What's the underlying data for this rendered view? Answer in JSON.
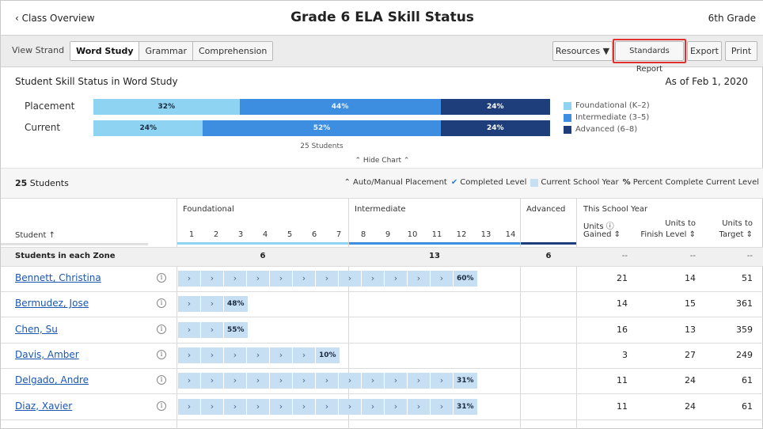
{
  "header": {
    "back_label": "Class Overview",
    "title": "Grade 6 ELA Skill Status",
    "grade": "6th Grade"
  },
  "toolbar": {
    "view_strand_label": "View Strand",
    "strand_tabs": [
      "Word Study",
      "Grammar",
      "Comprehension"
    ],
    "active_tab": "Word Study",
    "resources_label": "Resources ▼",
    "standards_label": "Standards Report",
    "export_label": "Export",
    "print_label": "Print"
  },
  "summary": {
    "title": "Student Skill Status in Word Study",
    "as_of": "As of Feb 1, 2020",
    "placement_label": "Placement",
    "current_label": "Current",
    "placement": [
      32,
      44,
      24
    ],
    "current": [
      24,
      52,
      24
    ],
    "placement_labels": [
      "32%",
      "44%",
      "24%"
    ],
    "current_labels": [
      "24%",
      "52%",
      "24%"
    ],
    "students_total": "25 Students",
    "hide_chart": "⌃ Hide Chart ⌃",
    "legend": [
      {
        "label": "Foundational (K–2)",
        "color": "#8fd3f2"
      },
      {
        "label": "Intermediate (3–5)",
        "color": "#3d8ee0"
      },
      {
        "label": "Advanced (6–8)",
        "color": "#1d3e7a"
      }
    ]
  },
  "students_band": {
    "count_bold": "25",
    "count_rest": " Students",
    "key_auto": "⌃ Auto/Manual Placement",
    "key_completed": "Completed Level",
    "key_current": "Current School Year",
    "key_percent_symbol": "%",
    "key_percent": "Percent Complete Current Level"
  },
  "table": {
    "student_header": "Student ↑",
    "zones": [
      "Foundational",
      "Intermediate",
      "Advanced"
    ],
    "levels": [
      "1",
      "2",
      "3",
      "4",
      "5",
      "6",
      "7",
      "8",
      "9",
      "10",
      "11",
      "12",
      "13",
      "14"
    ],
    "this_school_year": "This School Year",
    "units_gained": "Units ⓘ Gained ⇕",
    "units_gained_l1": "Units ⓘ",
    "units_gained_l2": "Gained ⇕",
    "units_finish_l1": "Units to",
    "units_finish_l2": "Finish Level ⇕",
    "units_target_l1": "Units to",
    "units_target_l2": "Target ⇕",
    "zone_row_label": "Students in each Zone",
    "zone_counts": [
      "6",
      "13",
      "6"
    ],
    "zone_totals": [
      "--",
      "--",
      "--"
    ],
    "rows": [
      {
        "name": "Bennett, Christina",
        "completed": 12,
        "pct": "60%",
        "gained": "21",
        "finish": "14",
        "target": "51"
      },
      {
        "name": "Bermudez, Jose",
        "completed": 2,
        "pct": "48%",
        "gained": "14",
        "finish": "15",
        "target": "361"
      },
      {
        "name": "Chen, Su",
        "completed": 2,
        "pct": "55%",
        "gained": "16",
        "finish": "13",
        "target": "359"
      },
      {
        "name": "Davis, Amber",
        "completed": 6,
        "pct": "10%",
        "gained": "3",
        "finish": "27",
        "target": "249"
      },
      {
        "name": "Delgado, Andre",
        "completed": 12,
        "pct": "31%",
        "gained": "11",
        "finish": "24",
        "target": "61"
      },
      {
        "name": "Diaz, Xavier",
        "completed": 12,
        "pct": "31%",
        "gained": "11",
        "finish": "24",
        "target": "61"
      }
    ]
  }
}
